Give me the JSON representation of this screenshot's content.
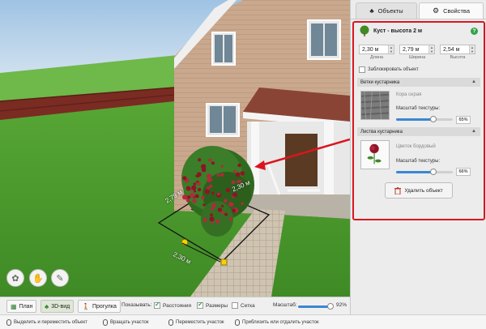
{
  "tabs": {
    "objects": "Объекты",
    "properties": "Свойства"
  },
  "object": {
    "title": "Куст - высота 2 м",
    "help": "?",
    "length": "2,30 м",
    "width": "2,79 м",
    "height": "2,54 м",
    "length_label": "Длина",
    "width_label": "Ширина",
    "height_label": "Высота",
    "lock_label": "Заблокировать объект"
  },
  "branches": {
    "header": "Ветки кустарника",
    "material": "Кора серая",
    "scale_label": "Масштаб текстуры:",
    "scale_value": "65%",
    "scale_fraction": 0.65
  },
  "leaves": {
    "header": "Листва кустарника",
    "material": "Цветок бордовый",
    "scale_label": "Масштаб текстуры:",
    "scale_value": "66%",
    "scale_fraction": 0.66
  },
  "delete_button": "Удалить объект",
  "scene": {
    "dim_top": "2,30 м",
    "dim_left": "2,79 м",
    "dim_bottom": "2,30 м"
  },
  "bottombar": {
    "plan": "План",
    "view3d": "3D-вид",
    "walk": "Прогулка",
    "show_label": "Показывать:",
    "distances": "Расстояния",
    "sizes": "Размеры",
    "grid": "Сетка",
    "zoom_label": "Масштаб:",
    "zoom_value": "92%",
    "zoom_fraction": 0.92
  },
  "statusbar": {
    "hint1": "Выделить и переместить объект",
    "hint2": "Вращать участок",
    "hint3": "Переместить участок",
    "hint4": "Приблизить или отдалить участок"
  },
  "colors": {
    "accent_red": "#d9161f",
    "slider_blue": "#3b86d3",
    "grass": "#4c9e2c"
  }
}
